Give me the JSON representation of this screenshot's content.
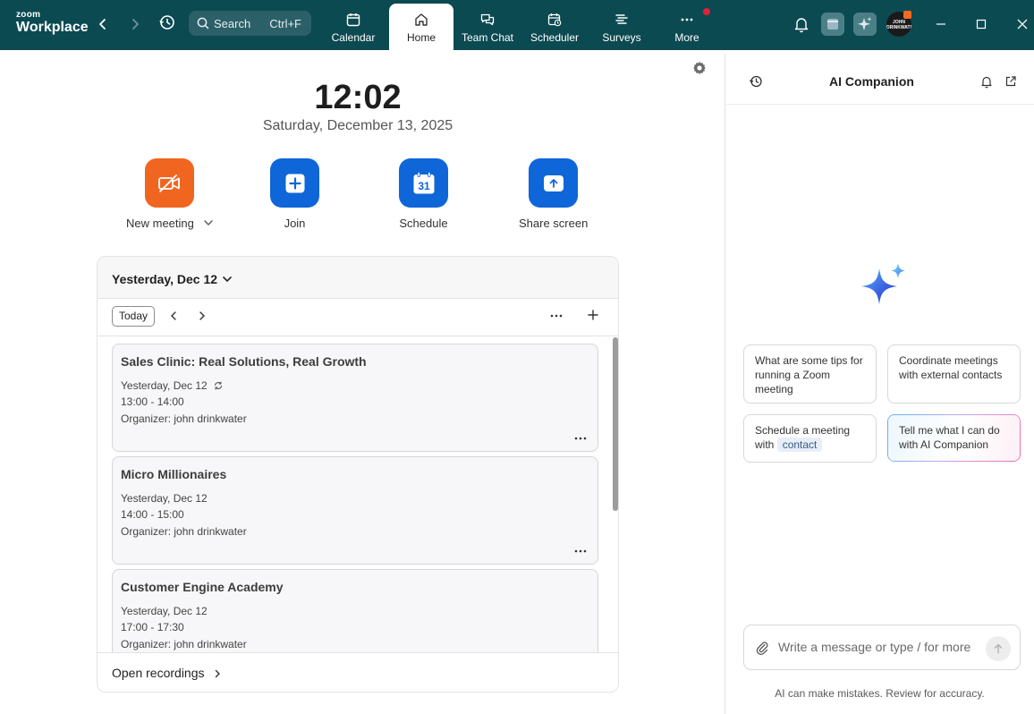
{
  "colors": {
    "topbar": "#0c4a52",
    "accent_blue": "#0e66d8",
    "accent_orange": "#f0651f",
    "badge_red": "#e0213b"
  },
  "app": {
    "logo_top": "zoom",
    "logo_bottom": "Workplace"
  },
  "search": {
    "label": "Search",
    "shortcut": "Ctrl+F"
  },
  "tabs": [
    {
      "label": "Calendar",
      "icon": "calendar-icon"
    },
    {
      "label": "Home",
      "icon": "home-icon",
      "active": true
    },
    {
      "label": "Team Chat",
      "icon": "chat-icon"
    },
    {
      "label": "Scheduler",
      "icon": "scheduler-icon"
    },
    {
      "label": "Surveys",
      "icon": "surveys-icon"
    },
    {
      "label": "More",
      "icon": "more-icon",
      "has_notification": true
    }
  ],
  "user": {
    "avatar_text": "JOHN DRINKWATER"
  },
  "home": {
    "time": "12:02",
    "date": "Saturday, December 13, 2025",
    "actions": [
      {
        "label": "New meeting",
        "icon": "video-off-icon"
      },
      {
        "label": "Join",
        "icon": "plus-icon"
      },
      {
        "label": "Schedule",
        "icon": "calendar-31-icon",
        "day": "31"
      },
      {
        "label": "Share screen",
        "icon": "share-screen-icon"
      }
    ]
  },
  "calendar": {
    "day_title": "Yesterday, Dec 12",
    "today_button": "Today",
    "meetings": [
      {
        "title": "Sales Clinic: Real Solutions, Real Growth",
        "date": "Yesterday, Dec 12",
        "time": "13:00 - 14:00",
        "organizer": "Organizer: john drinkwater",
        "recurring": true
      },
      {
        "title": "Micro Millionaires",
        "date": "Yesterday, Dec 12",
        "time": "14:00 - 15:00",
        "organizer": "Organizer: john drinkwater",
        "recurring": false
      },
      {
        "title": "Customer Engine Academy",
        "date": "Yesterday, Dec 12",
        "time": "17:00 - 17:30",
        "organizer": "Organizer: john drinkwater",
        "recurring": false
      }
    ],
    "footer_link": "Open recordings"
  },
  "ai": {
    "title": "AI Companion",
    "suggestions": [
      {
        "text": "What are some tips for running a Zoom meeting"
      },
      {
        "text": "Coordinate meetings with external contacts"
      },
      {
        "text": "Schedule a meeting with",
        "chip": "contact"
      },
      {
        "text": "Tell me what I can do with AI Companion"
      }
    ],
    "input_placeholder": "Write a message or type / for more",
    "disclaimer": "AI can make mistakes. Review for accuracy."
  }
}
